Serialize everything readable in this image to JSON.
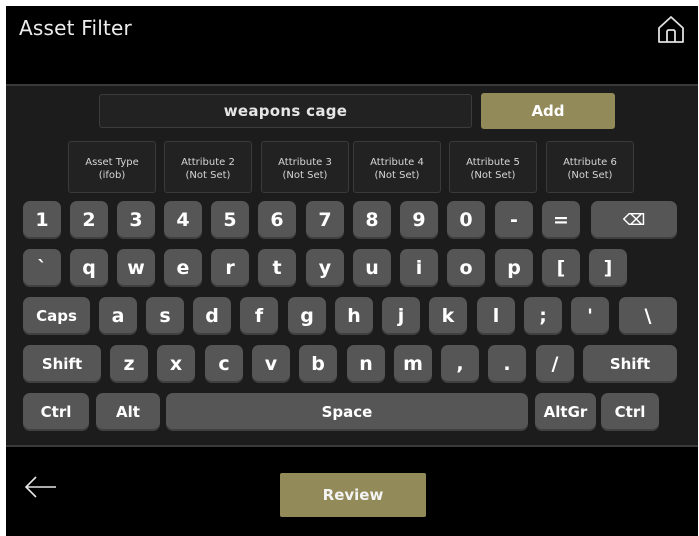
{
  "header": {
    "title": "Asset Filter",
    "home_icon": "home-icon"
  },
  "search": {
    "value": "weapons cage"
  },
  "add_label": "Add",
  "attributes": [
    {
      "line1": "Asset Type",
      "line2": "(ifob)"
    },
    {
      "line1": "Attribute 2",
      "line2": "(Not Set)"
    },
    {
      "line1": "Attribute 3",
      "line2": "(Not Set)"
    },
    {
      "line1": "Attribute 4",
      "line2": "(Not Set)"
    },
    {
      "line1": "Attribute 5",
      "line2": "(Not Set)"
    },
    {
      "line1": "Attribute 6",
      "line2": "(Not Set)"
    }
  ],
  "keyboard": {
    "row1": [
      "1",
      "2",
      "3",
      "4",
      "5",
      "6",
      "7",
      "8",
      "9",
      "0",
      "-",
      "=",
      "⌫"
    ],
    "row2": [
      "`",
      "q",
      "w",
      "e",
      "r",
      "t",
      "y",
      "u",
      "i",
      "o",
      "p",
      "[",
      "]"
    ],
    "row3": [
      "Caps",
      "a",
      "s",
      "d",
      "f",
      "g",
      "h",
      "j",
      "k",
      "l",
      ";",
      "'",
      "\\"
    ],
    "row4": [
      "Shift",
      "z",
      "x",
      "c",
      "v",
      "b",
      "n",
      "m",
      ",",
      ".",
      "/",
      "Shift"
    ],
    "row5": [
      "Ctrl",
      "Alt",
      "Space",
      "AltGr",
      "Ctrl"
    ]
  },
  "review_label": "Review",
  "colors": {
    "accent": "#938a5a",
    "key": "#565656",
    "panel": "#1c1c1c"
  }
}
